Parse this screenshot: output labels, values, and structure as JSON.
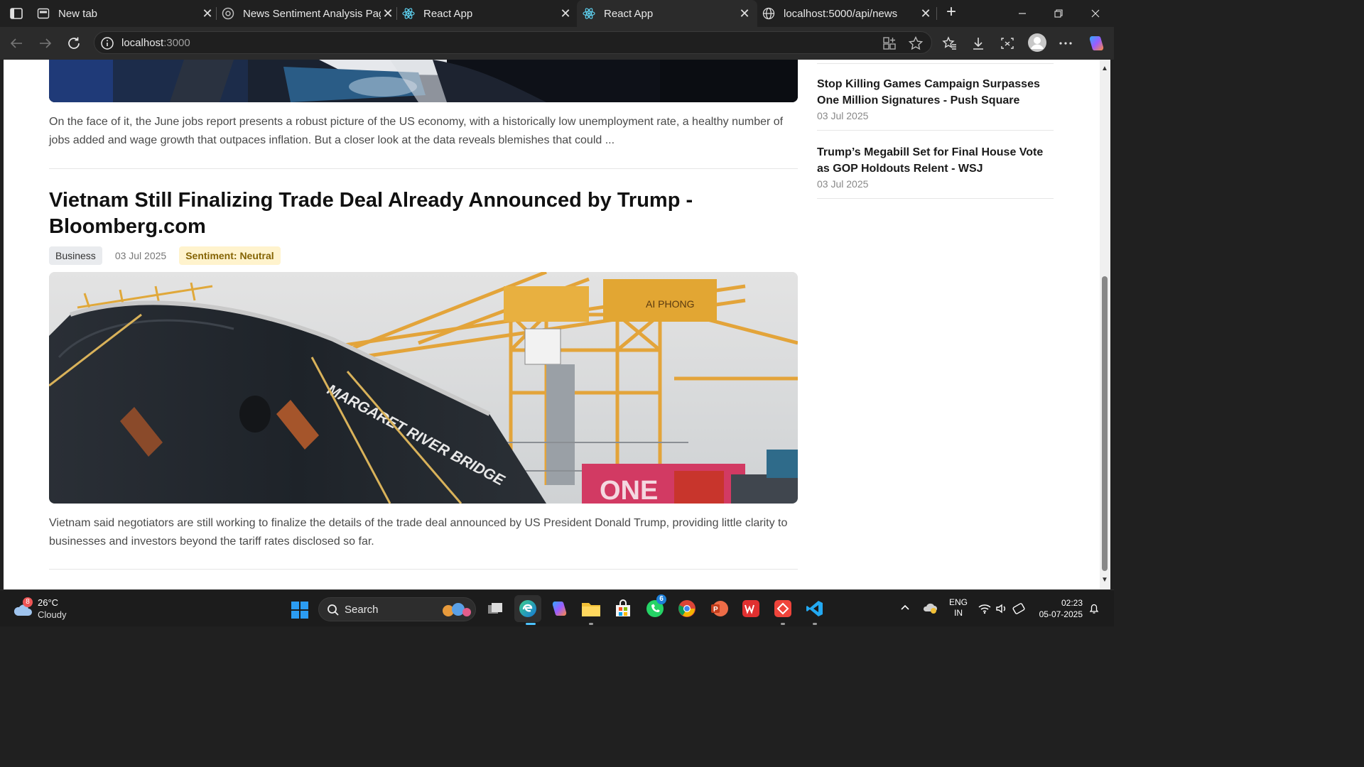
{
  "browser": {
    "tabs": [
      {
        "title": "New tab"
      },
      {
        "title": "News Sentiment Analysis Page"
      },
      {
        "title": "React App"
      },
      {
        "title": "React App"
      },
      {
        "title": "localhost:5000/api/news"
      }
    ],
    "address": {
      "host": "localhost",
      "port": ":3000"
    }
  },
  "main": {
    "prev_excerpt": "On the face of it, the June jobs report presents a robust picture of the US economy, with a historically low unemployment rate, a healthy number of jobs added and wage growth that outpaces inflation. But a closer look at the data reveals blemishes that could ...",
    "article": {
      "headline": "Vietnam Still Finalizing Trade Deal Already Announced by Trump - Bloomberg.com",
      "category": "Business",
      "date": "03 Jul 2025",
      "sentiment": "Sentiment: Neutral",
      "image_text": {
        "ship": "MARGARET RIVER BRIDGE",
        "crane": "AI PHONG",
        "container": "ONE"
      },
      "excerpt": "Vietnam said negotiators are still working to finalize the details of the trade deal announced by US President Donald Trump, providing little clarity to businesses and investors beyond the tariff rates disclosed so far."
    }
  },
  "sidebar": {
    "items": [
      {
        "title": "Stop Killing Games Campaign Surpasses One Million Signatures - Push Square",
        "date": "03 Jul 2025"
      },
      {
        "title": "Trump’s Megabill Set for Final House Vote as GOP Holdouts Relent - WSJ",
        "date": "03 Jul 2025"
      }
    ]
  },
  "taskbar": {
    "weather": {
      "temp": "26°C",
      "condition": "Cloudy",
      "badge": "8"
    },
    "search_label": "Search",
    "whatsapp_badge": "6",
    "lang": {
      "line1": "ENG",
      "line2": "IN"
    },
    "time": "02:23",
    "date": "05-07-2025"
  }
}
